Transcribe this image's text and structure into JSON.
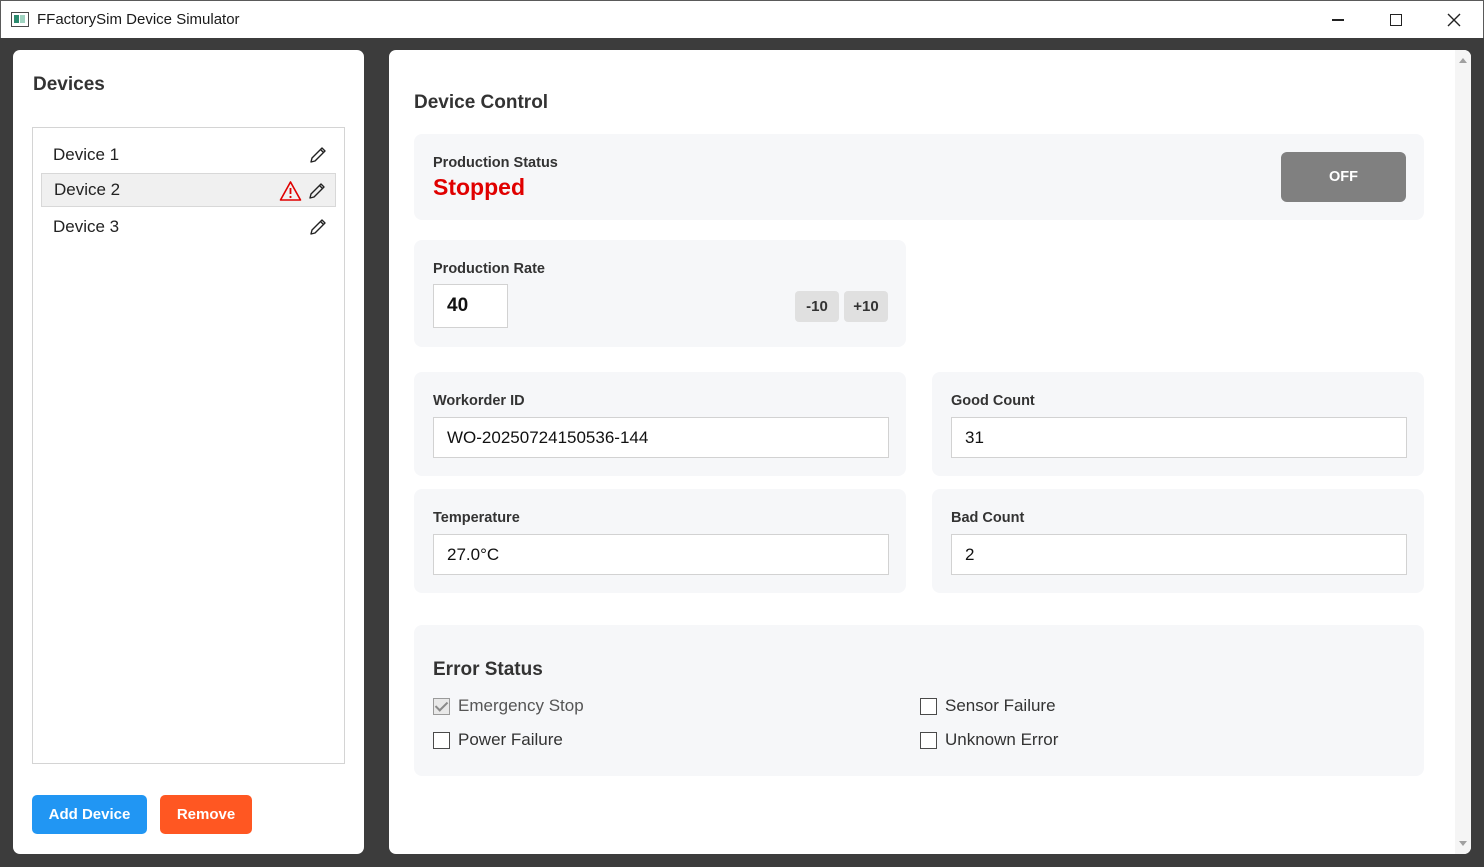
{
  "window": {
    "title": "FFactorySim Device Simulator",
    "controls": [
      "minimize-icon",
      "maximize-icon",
      "close-icon"
    ]
  },
  "sidebar": {
    "title": "Devices",
    "devices": [
      {
        "label": "Device 1",
        "selected": false,
        "warning": false,
        "icon": "edit-icon"
      },
      {
        "label": "Device 2",
        "selected": true,
        "warning": true,
        "icon": "edit-icon"
      },
      {
        "label": "Device 3",
        "selected": false,
        "warning": false,
        "icon": "edit-icon"
      }
    ],
    "add_label": "Add Device",
    "remove_label": "Remove"
  },
  "main": {
    "title": "Device Control",
    "production_status": {
      "label": "Production Status",
      "value": "Stopped",
      "toggle_label": "OFF"
    },
    "production_rate": {
      "label": "Production Rate",
      "value": "40",
      "decrement_label": "-10",
      "increment_label": "+10"
    },
    "workorder": {
      "label": "Workorder ID",
      "value": "WO-20250724150536-144"
    },
    "good_count": {
      "label": "Good Count",
      "value": "31"
    },
    "temperature": {
      "label": "Temperature",
      "value": "27.0°C"
    },
    "bad_count": {
      "label": "Bad Count",
      "value": "2"
    },
    "error_status": {
      "title": "Error Status",
      "items": [
        {
          "label": "Emergency Stop",
          "checked": true,
          "disabled": true
        },
        {
          "label": "Sensor Failure",
          "checked": false,
          "disabled": false
        },
        {
          "label": "Power Failure",
          "checked": false,
          "disabled": false
        },
        {
          "label": "Unknown Error",
          "checked": false,
          "disabled": false
        }
      ]
    }
  },
  "colors": {
    "add_button": "#2196f3",
    "remove_button": "#ff5722",
    "status_stopped": "#e00000",
    "toggle_off": "#808080",
    "warning": "#e00000"
  }
}
